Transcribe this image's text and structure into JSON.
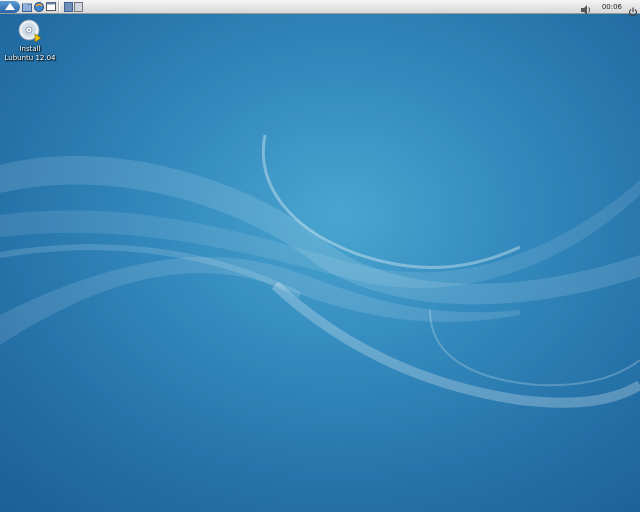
{
  "panel": {
    "launchers": [
      {
        "name": "menu-icon"
      },
      {
        "name": "file-manager-icon"
      },
      {
        "name": "web-browser-icon"
      },
      {
        "name": "minimize-all-icon"
      }
    ],
    "desktops": [
      {
        "active": true
      },
      {
        "active": false
      }
    ],
    "tray": {
      "volume_icon": "speaker-icon",
      "clock": "00:06",
      "power_icon": "power-icon"
    }
  },
  "desktop": {
    "icons": [
      {
        "label_line1": "Install",
        "label_line2": "Lubuntu 12.04",
        "icon": "cd-install-icon"
      }
    ]
  },
  "colors": {
    "wallpaper_center": "#4aa6d0",
    "wallpaper_edge": "#1b5e95",
    "panel_bg": "#e6e6e6",
    "menu_button": "#2c68a8"
  }
}
